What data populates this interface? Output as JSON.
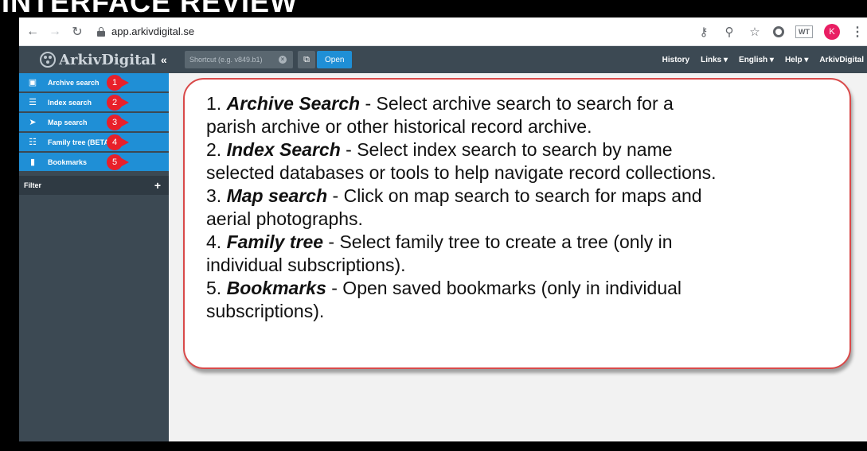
{
  "crop_heading": "INTERFACE REVIEW",
  "browser": {
    "url": "app.arkivdigital.se",
    "avatar_letter": "K",
    "extension_label": "WT"
  },
  "app": {
    "logo_text": "ArkivDigital",
    "shortcut_placeholder": "Shortcut (e.g. v849.b1)",
    "open_label": "Open",
    "nav_links": [
      "History",
      "Links ▾",
      "English ▾",
      "Help ▾",
      "ArkivDigital"
    ]
  },
  "sidebar": {
    "items": [
      {
        "label": "Archive search",
        "icon": "archive-icon",
        "badge": "1"
      },
      {
        "label": "Index search",
        "icon": "list-icon",
        "badge": "2"
      },
      {
        "label": "Map search",
        "icon": "location-arrow-icon",
        "badge": "3"
      },
      {
        "label": "Family tree (BETA)",
        "icon": "family-tree-icon",
        "badge": "4"
      },
      {
        "label": "Bookmarks",
        "icon": "bookmark-icon",
        "badge": "5"
      }
    ],
    "filter_label": "Filter"
  },
  "callout": {
    "items": [
      {
        "num": "1.",
        "term": "Archive Search",
        "text": " - Select archive search to search for a parish archive or other historical record archive."
      },
      {
        "num": "2.",
        "term": "Index Search",
        "text": " - Select index search to search by name selected databases or tools to help navigate record collections."
      },
      {
        "num": "3.",
        "term": "Map search",
        "text": " - Click on map search to search for maps and aerial photographs."
      },
      {
        "num": "4.",
        "term": "Family tree",
        "text": " - Select family tree to create a tree (only in individual subscriptions)."
      },
      {
        "num": "5.",
        "term": "Bookmarks",
        "text": " - Open saved bookmarks (only in individual subscriptions)."
      }
    ],
    "lines": [
      {
        "num": "1. ",
        "term": "Archive Search",
        "rest": " - Select archive search to search for a"
      },
      {
        "num": "",
        "term": "",
        "rest": "parish archive or other historical record archive."
      },
      {
        "num": "2. ",
        "term": "Index Search",
        "rest": " - Select index search to search by name"
      },
      {
        "num": "",
        "term": "",
        "rest": "selected databases or tools to help navigate record collections."
      },
      {
        "num": "3. ",
        "term": "Map search",
        "rest": " - Click on map search to search for maps and"
      },
      {
        "num": "",
        "term": "",
        "rest": "aerial photographs."
      },
      {
        "num": "4. ",
        "term": "Family tree",
        "rest": " - Select family tree to create a tree (only in"
      },
      {
        "num": "",
        "term": "",
        "rest": "individual subscriptions)."
      },
      {
        "num": "5. ",
        "term": "Bookmarks",
        "rest": " - Open saved bookmarks (only in individual"
      },
      {
        "num": "",
        "term": "",
        "rest": "subscriptions)."
      }
    ]
  },
  "colors": {
    "nav_bg": "#3c4953",
    "sidebar_item": "#1f8fd6",
    "badge_red": "#e8202a",
    "callout_border": "#d94a4a"
  }
}
